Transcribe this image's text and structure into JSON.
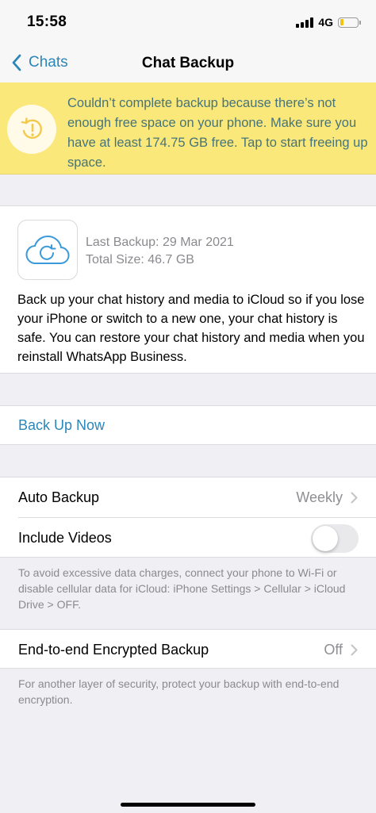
{
  "status_bar": {
    "time": "15:58",
    "network": "4G",
    "battery_level": 0.2,
    "battery_color": "#f1c40f"
  },
  "nav": {
    "back_label": "Chats",
    "title": "Chat Backup"
  },
  "warning": {
    "text": "Couldn’t complete backup because there’s not enough free space on your phone. Make sure you have at least 174.75 GB free. Tap to start freeing up space.",
    "background": "#fbe87b",
    "text_color": "#46747a",
    "icon": "backup-warning-icon"
  },
  "backup_info": {
    "icon": "icloud-backup-icon",
    "last_backup": "Last Backup: 29 Mar 2021",
    "total_size": "Total Size: 46.7 GB",
    "description": "Back up your chat history and media to iCloud so if you lose your iPhone or switch to a new one, your chat history is safe. You can restore your chat history and media when you reinstall WhatsApp Business."
  },
  "back_up_now": {
    "label": "Back Up Now",
    "color": "#2b86b9"
  },
  "settings": {
    "auto_backup": {
      "label": "Auto Backup",
      "value": "Weekly"
    },
    "include_videos": {
      "label": "Include Videos",
      "enabled": false
    },
    "footnote": "To avoid excessive data charges, connect your phone to Wi-Fi or disable cellular data for iCloud: iPhone Settings > Cellular > iCloud Drive > OFF."
  },
  "e2e": {
    "label": "End-to-end Encrypted Backup",
    "value": "Off",
    "footnote": "For another layer of security, protect your backup with end-to-end encryption."
  }
}
